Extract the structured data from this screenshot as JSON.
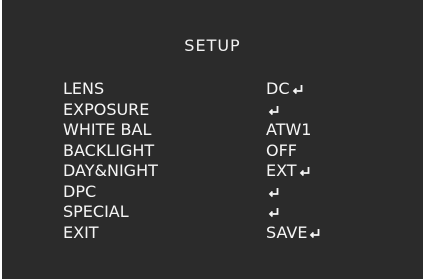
{
  "osd": {
    "title": "SETUP",
    "items": [
      {
        "label": "LENS",
        "value": "DC",
        "submenu": true
      },
      {
        "label": "EXPOSURE",
        "value": "",
        "submenu": true
      },
      {
        "label": "WHITE BAL",
        "value": "ATW1",
        "submenu": false
      },
      {
        "label": "BACKLIGHT",
        "value": "OFF",
        "submenu": false
      },
      {
        "label": "DAY&NIGHT",
        "value": "EXT",
        "submenu": true
      },
      {
        "label": "DPC",
        "value": "",
        "submenu": true
      },
      {
        "label": "SPECIAL",
        "value": "",
        "submenu": true
      },
      {
        "label": "EXIT",
        "value": "SAVE",
        "submenu": true
      }
    ]
  },
  "icons": {
    "submenu": "enter-return-icon"
  },
  "colors": {
    "background": "#2b2b2b",
    "text": "#f5f5f5"
  }
}
